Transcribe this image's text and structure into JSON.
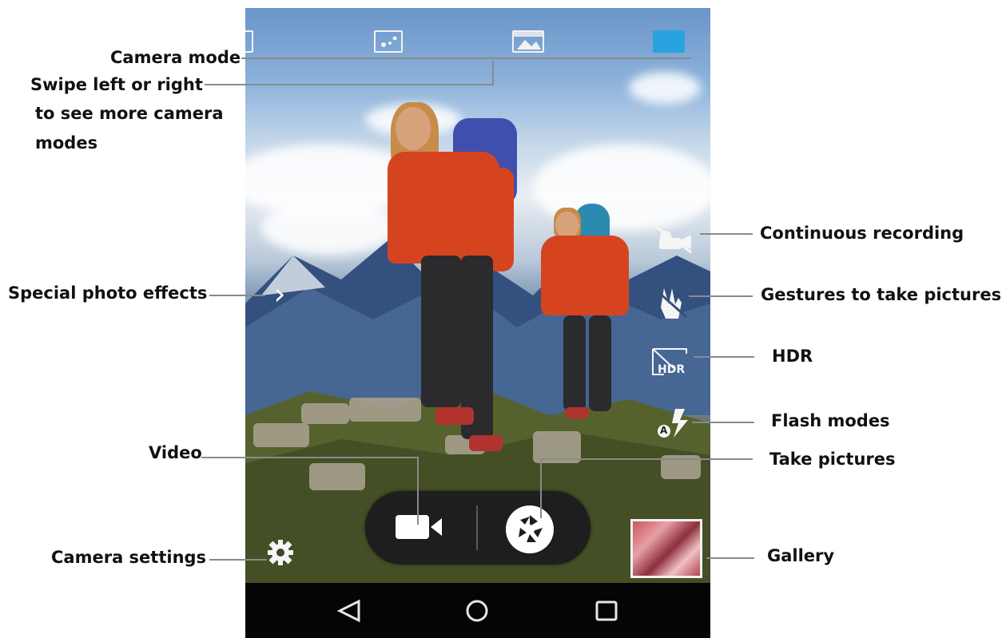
{
  "callouts": {
    "camera_mode": "Camera mode",
    "swipe_line1": "Swipe left or right",
    "swipe_line2": "to see more camera",
    "swipe_line3": "modes",
    "special_effects": "Special photo effects",
    "continuous_recording": "Continuous recording",
    "gestures": "Gestures to take pictures",
    "hdr": "HDR",
    "flash_modes": "Flash modes",
    "video": "Video",
    "take_pictures": "Take pictures",
    "camera_settings": "Camera settings",
    "gallery": "Gallery"
  },
  "camera_ui": {
    "hdr_icon_text": "HDR",
    "flash_auto_text": "A",
    "effects_chevron": "›"
  },
  "colors": {
    "accent_mode": "#29a3e0",
    "capture_bar": "#1e1e1e",
    "nav_bar": "#050505"
  },
  "icons": [
    "panorama-icon",
    "scene-icon",
    "landscape-icon",
    "photo-mode-icon",
    "continuous-recording-icon",
    "gesture-icon",
    "hdr-icon",
    "flash-auto-icon",
    "chevron-right-icon",
    "video-camera-icon",
    "shutter-icon",
    "settings-gear-icon",
    "back-icon",
    "home-icon",
    "recents-icon"
  ]
}
